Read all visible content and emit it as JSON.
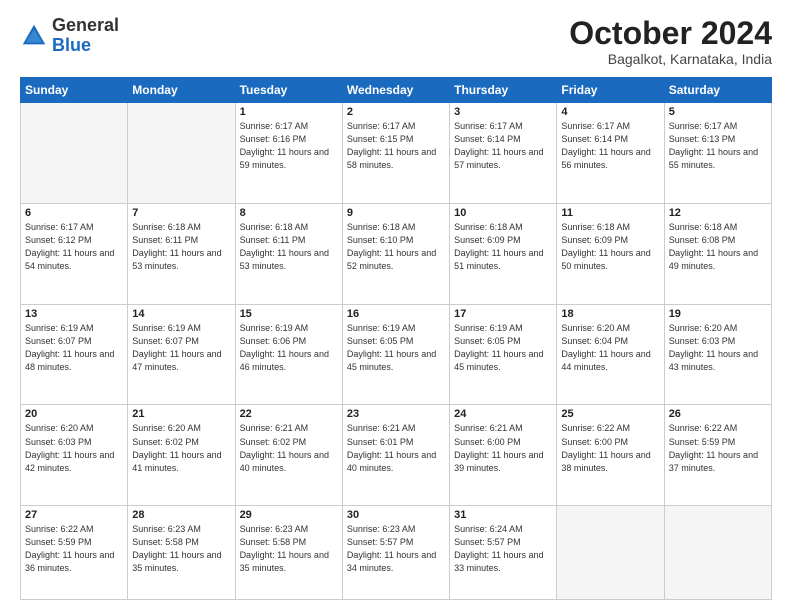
{
  "header": {
    "logo_general": "General",
    "logo_blue": "Blue",
    "month_title": "October 2024",
    "location": "Bagalkot, Karnataka, India"
  },
  "days_of_week": [
    "Sunday",
    "Monday",
    "Tuesday",
    "Wednesday",
    "Thursday",
    "Friday",
    "Saturday"
  ],
  "weeks": [
    [
      {
        "day": "",
        "empty": true
      },
      {
        "day": "",
        "empty": true
      },
      {
        "day": "1",
        "sunrise": "Sunrise: 6:17 AM",
        "sunset": "Sunset: 6:16 PM",
        "daylight": "Daylight: 11 hours and 59 minutes."
      },
      {
        "day": "2",
        "sunrise": "Sunrise: 6:17 AM",
        "sunset": "Sunset: 6:15 PM",
        "daylight": "Daylight: 11 hours and 58 minutes."
      },
      {
        "day": "3",
        "sunrise": "Sunrise: 6:17 AM",
        "sunset": "Sunset: 6:14 PM",
        "daylight": "Daylight: 11 hours and 57 minutes."
      },
      {
        "day": "4",
        "sunrise": "Sunrise: 6:17 AM",
        "sunset": "Sunset: 6:14 PM",
        "daylight": "Daylight: 11 hours and 56 minutes."
      },
      {
        "day": "5",
        "sunrise": "Sunrise: 6:17 AM",
        "sunset": "Sunset: 6:13 PM",
        "daylight": "Daylight: 11 hours and 55 minutes."
      }
    ],
    [
      {
        "day": "6",
        "sunrise": "Sunrise: 6:17 AM",
        "sunset": "Sunset: 6:12 PM",
        "daylight": "Daylight: 11 hours and 54 minutes."
      },
      {
        "day": "7",
        "sunrise": "Sunrise: 6:18 AM",
        "sunset": "Sunset: 6:11 PM",
        "daylight": "Daylight: 11 hours and 53 minutes."
      },
      {
        "day": "8",
        "sunrise": "Sunrise: 6:18 AM",
        "sunset": "Sunset: 6:11 PM",
        "daylight": "Daylight: 11 hours and 53 minutes."
      },
      {
        "day": "9",
        "sunrise": "Sunrise: 6:18 AM",
        "sunset": "Sunset: 6:10 PM",
        "daylight": "Daylight: 11 hours and 52 minutes."
      },
      {
        "day": "10",
        "sunrise": "Sunrise: 6:18 AM",
        "sunset": "Sunset: 6:09 PM",
        "daylight": "Daylight: 11 hours and 51 minutes."
      },
      {
        "day": "11",
        "sunrise": "Sunrise: 6:18 AM",
        "sunset": "Sunset: 6:09 PM",
        "daylight": "Daylight: 11 hours and 50 minutes."
      },
      {
        "day": "12",
        "sunrise": "Sunrise: 6:18 AM",
        "sunset": "Sunset: 6:08 PM",
        "daylight": "Daylight: 11 hours and 49 minutes."
      }
    ],
    [
      {
        "day": "13",
        "sunrise": "Sunrise: 6:19 AM",
        "sunset": "Sunset: 6:07 PM",
        "daylight": "Daylight: 11 hours and 48 minutes."
      },
      {
        "day": "14",
        "sunrise": "Sunrise: 6:19 AM",
        "sunset": "Sunset: 6:07 PM",
        "daylight": "Daylight: 11 hours and 47 minutes."
      },
      {
        "day": "15",
        "sunrise": "Sunrise: 6:19 AM",
        "sunset": "Sunset: 6:06 PM",
        "daylight": "Daylight: 11 hours and 46 minutes."
      },
      {
        "day": "16",
        "sunrise": "Sunrise: 6:19 AM",
        "sunset": "Sunset: 6:05 PM",
        "daylight": "Daylight: 11 hours and 45 minutes."
      },
      {
        "day": "17",
        "sunrise": "Sunrise: 6:19 AM",
        "sunset": "Sunset: 6:05 PM",
        "daylight": "Daylight: 11 hours and 45 minutes."
      },
      {
        "day": "18",
        "sunrise": "Sunrise: 6:20 AM",
        "sunset": "Sunset: 6:04 PM",
        "daylight": "Daylight: 11 hours and 44 minutes."
      },
      {
        "day": "19",
        "sunrise": "Sunrise: 6:20 AM",
        "sunset": "Sunset: 6:03 PM",
        "daylight": "Daylight: 11 hours and 43 minutes."
      }
    ],
    [
      {
        "day": "20",
        "sunrise": "Sunrise: 6:20 AM",
        "sunset": "Sunset: 6:03 PM",
        "daylight": "Daylight: 11 hours and 42 minutes."
      },
      {
        "day": "21",
        "sunrise": "Sunrise: 6:20 AM",
        "sunset": "Sunset: 6:02 PM",
        "daylight": "Daylight: 11 hours and 41 minutes."
      },
      {
        "day": "22",
        "sunrise": "Sunrise: 6:21 AM",
        "sunset": "Sunset: 6:02 PM",
        "daylight": "Daylight: 11 hours and 40 minutes."
      },
      {
        "day": "23",
        "sunrise": "Sunrise: 6:21 AM",
        "sunset": "Sunset: 6:01 PM",
        "daylight": "Daylight: 11 hours and 40 minutes."
      },
      {
        "day": "24",
        "sunrise": "Sunrise: 6:21 AM",
        "sunset": "Sunset: 6:00 PM",
        "daylight": "Daylight: 11 hours and 39 minutes."
      },
      {
        "day": "25",
        "sunrise": "Sunrise: 6:22 AM",
        "sunset": "Sunset: 6:00 PM",
        "daylight": "Daylight: 11 hours and 38 minutes."
      },
      {
        "day": "26",
        "sunrise": "Sunrise: 6:22 AM",
        "sunset": "Sunset: 5:59 PM",
        "daylight": "Daylight: 11 hours and 37 minutes."
      }
    ],
    [
      {
        "day": "27",
        "sunrise": "Sunrise: 6:22 AM",
        "sunset": "Sunset: 5:59 PM",
        "daylight": "Daylight: 11 hours and 36 minutes."
      },
      {
        "day": "28",
        "sunrise": "Sunrise: 6:23 AM",
        "sunset": "Sunset: 5:58 PM",
        "daylight": "Daylight: 11 hours and 35 minutes."
      },
      {
        "day": "29",
        "sunrise": "Sunrise: 6:23 AM",
        "sunset": "Sunset: 5:58 PM",
        "daylight": "Daylight: 11 hours and 35 minutes."
      },
      {
        "day": "30",
        "sunrise": "Sunrise: 6:23 AM",
        "sunset": "Sunset: 5:57 PM",
        "daylight": "Daylight: 11 hours and 34 minutes."
      },
      {
        "day": "31",
        "sunrise": "Sunrise: 6:24 AM",
        "sunset": "Sunset: 5:57 PM",
        "daylight": "Daylight: 11 hours and 33 minutes."
      },
      {
        "day": "",
        "empty": true
      },
      {
        "day": "",
        "empty": true
      }
    ]
  ]
}
